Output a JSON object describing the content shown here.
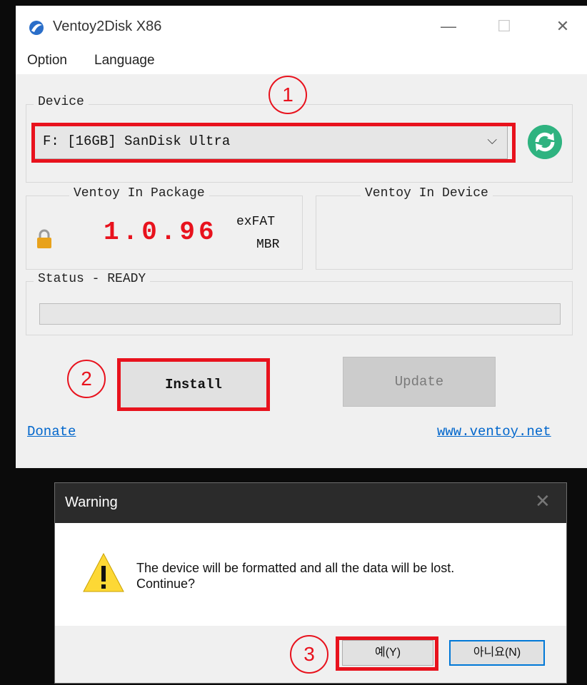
{
  "window": {
    "title": "Ventoy2Disk  X86",
    "min_label": "—",
    "max_label": "☐",
    "close_label": "✕"
  },
  "menu": {
    "option": "Option",
    "language": "Language"
  },
  "device": {
    "label": "Device",
    "selected": "F: [16GB] SanDisk Ultra",
    "chevron": "⌵"
  },
  "package": {
    "label": "Ventoy In Package",
    "version": "1.0.96",
    "filesystem": "exFAT",
    "partition": "MBR"
  },
  "in_device": {
    "label": "Ventoy In Device"
  },
  "status": {
    "label": "Status - READY",
    "progress": 0
  },
  "buttons": {
    "install": "Install",
    "update": "Update"
  },
  "links": {
    "donate": "Donate",
    "website": "www.ventoy.net"
  },
  "annotations": {
    "step1": "1",
    "step2": "2",
    "step3": "3"
  },
  "dialog": {
    "title": "Warning",
    "close": "✕",
    "message_line1": "The device will be formatted and all the data will be lost.",
    "message_line2": "Continue?",
    "yes": "예(Y)",
    "no": "아니요(N)"
  },
  "colors": {
    "accent_red": "#e8121d",
    "refresh_green": "#2fb380",
    "link_blue": "#0066cc",
    "focus_blue": "#0078d7"
  }
}
